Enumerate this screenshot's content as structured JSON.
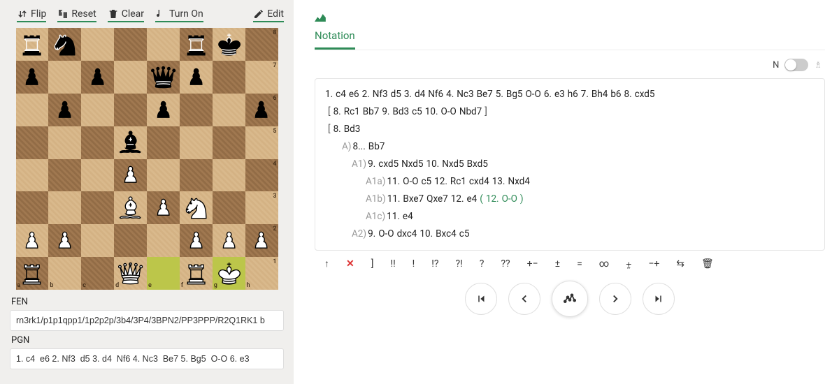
{
  "toolbar": {
    "flip": "Flip",
    "reset": "Reset",
    "clear": "Clear",
    "turnOn": "Turn On",
    "edit": "Edit"
  },
  "labels": {
    "fen": "FEN",
    "pgn": "PGN"
  },
  "fields": {
    "fen": "rn3rk1/p1p1qpp1/1p2p2p/3b4/3P4/3BPN2/PP3PPP/R2Q1RK1 b",
    "pgn": "1. c4  e6 2. Nf3  d5 3. d4  Nf6 4. Nc3  Be7 5. Bg5  O-O 6. e3"
  },
  "board": {
    "files": [
      "a",
      "b",
      "c",
      "d",
      "e",
      "f",
      "g",
      "h"
    ],
    "ranks": [
      "8",
      "7",
      "6",
      "5",
      "4",
      "3",
      "2",
      "1"
    ],
    "position": {
      "a8": "bR",
      "b8": "bN",
      "f8": "bR",
      "g8": "bK",
      "a7": "bP",
      "c7": "bP",
      "e7": "bQ",
      "f7": "bP",
      "b6": "bP",
      "e6": "bP",
      "h6": "bP",
      "d5": "bB",
      "d4": "wP",
      "d3": "wB",
      "e3": "wP",
      "f3": "wN",
      "a2": "wP",
      "b2": "wP",
      "f2": "wP",
      "g2": "wP",
      "h2": "wP",
      "a1": "wR",
      "d1": "wQ",
      "f1": "wR",
      "g1": "wK"
    },
    "highlights": [
      "e1",
      "g1"
    ]
  },
  "tabs": {
    "notation": "Notation"
  },
  "topControls": {
    "nLabel": "N",
    "toggleOn": false
  },
  "notation": {
    "mainline": [
      {
        "n": "1.",
        "w": "c4",
        "b": "e6"
      },
      {
        "n": "2.",
        "w": "Nf3",
        "b": "d5"
      },
      {
        "n": "3.",
        "w": "d4",
        "b": "Nf6"
      },
      {
        "n": "4.",
        "w": "Nc3",
        "b": "Be7"
      },
      {
        "n": "5.",
        "w": "Bg5",
        "b": "O-O"
      },
      {
        "n": "6.",
        "w": "e3",
        "b": "h6"
      },
      {
        "n": "7.",
        "w": "Bh4",
        "b": "b6"
      },
      {
        "n": "8.",
        "w": "cxd5",
        "b": ""
      }
    ],
    "varBracket1": [
      "8.",
      "Rc1",
      "Bb7",
      "9.",
      "Bd3",
      "c5",
      "10.",
      "O-O",
      "Nbd7"
    ],
    "varOpen2": [
      "8.",
      "Bd3"
    ],
    "lineA": {
      "label": "A)",
      "moves": [
        "8...",
        "Bb7"
      ]
    },
    "lineA1": {
      "label": "A1)",
      "moves": [
        "9.",
        "cxd5",
        "Nxd5",
        "10.",
        "Nxd5",
        "Bxd5"
      ]
    },
    "lineA1a": {
      "label": "A1a)",
      "moves": [
        "11.",
        "O-O",
        "c5",
        "12.",
        "Rc1",
        "cxd4",
        "13.",
        "Nxd4"
      ]
    },
    "lineA1b": {
      "label": "A1b)",
      "moves": [
        "11.",
        "Bxe7",
        "Qxe7",
        "12.",
        "e4"
      ],
      "paren": [
        "(",
        "12.",
        "O-O",
        ")"
      ]
    },
    "lineA1c": {
      "label": "A1c)",
      "moves": [
        "11.",
        "e4"
      ]
    },
    "lineA2": {
      "label": "A2)",
      "moves": [
        "9.",
        "O-O",
        "dxc4",
        "10.",
        "Bxc4",
        "c5"
      ]
    }
  },
  "symbols": [
    "↑",
    "✕",
    "]",
    "!!",
    "!",
    "!?",
    "?!",
    "?",
    "??",
    "+−",
    "±",
    "=",
    "∞",
    "⨦",
    "−+",
    "⇆",
    "🗑"
  ]
}
